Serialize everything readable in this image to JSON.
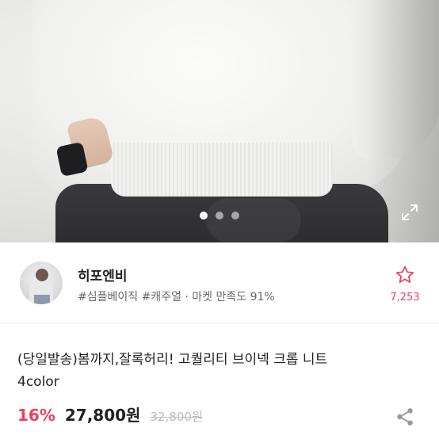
{
  "gallery": {
    "image_count": 3,
    "active_index": 0
  },
  "seller": {
    "name": "히포엔비",
    "tags": "#심플베이직 #캐주얼 · 마켓 만족도 91%"
  },
  "wishlist": {
    "count": "7,253"
  },
  "product": {
    "title_line1": "(당일발송)봄까지,잘록허리! 고퀄리티 브이넥 크롭 니트",
    "title_line2": "4color",
    "discount": "16%",
    "price": "27,800원",
    "original_price": "32,800원"
  },
  "colors": {
    "accent": "#ef3e5c",
    "text": "#222222",
    "muted": "#666666",
    "strike": "#bbbbbb"
  },
  "icons": [
    "expand-icon",
    "star-outline-icon",
    "share-icon"
  ]
}
